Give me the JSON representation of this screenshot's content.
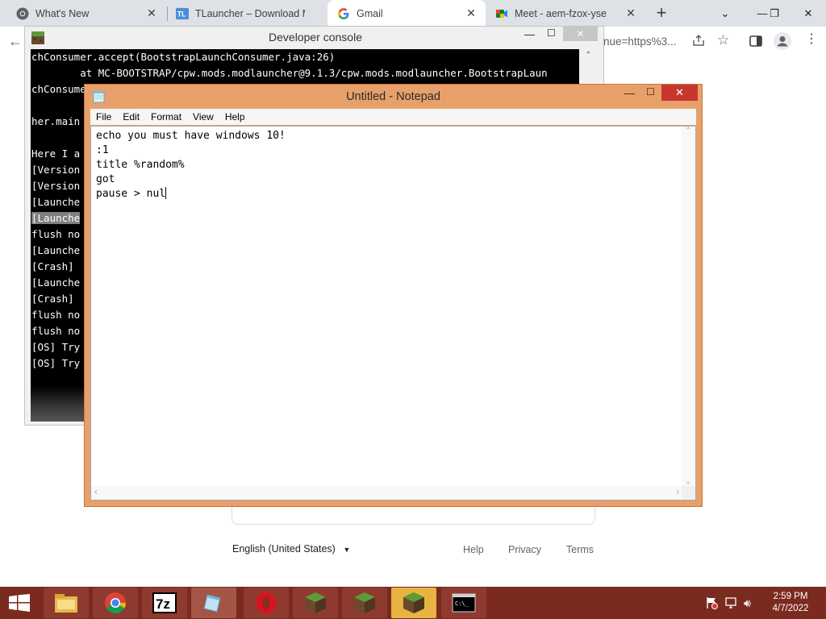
{
  "browser": {
    "tabs": [
      {
        "title": "What's New",
        "icon": "chrome-icon"
      },
      {
        "title": "TLauncher – Download M",
        "icon": "tlauncher-icon"
      },
      {
        "title": "Gmail",
        "icon": "google-icon",
        "active": true
      },
      {
        "title": "Meet - aem-fzox-yse",
        "icon": "meet-icon"
      }
    ],
    "new_tab": "+",
    "url_fragment": "nue=https%3...",
    "footer": {
      "language": "English (United States)",
      "links": [
        "Help",
        "Privacy",
        "Terms"
      ]
    }
  },
  "dev_console": {
    "title": "Developer console",
    "lines": [
      "chConsumer.accept(BootstrapLaunchConsumer.java:26)",
      "        at MC-BOOTSTRAP/cpw.mods.modlauncher@9.1.3/cpw.mods.modlauncher.BootstrapLaun",
      "chConsume",
      "        ",
      "her.main",
      "",
      "Here I a",
      "[Version",
      "[Version",
      "[Launche",
      "[Launche",
      "flush no",
      "[Launche",
      "[Crash] ",
      "[Launche",
      "[Crash] ",
      "flush no",
      "flush no",
      "[OS] Try",
      "[OS] Try"
    ]
  },
  "notepad": {
    "title": "Untitled - Notepad",
    "menu": [
      "File",
      "Edit",
      "Format",
      "View",
      "Help"
    ],
    "lines": [
      "echo you must have windows 10!",
      ":1",
      "title %random%",
      "got",
      "pause > nul"
    ]
  },
  "taskbar": {
    "apps": [
      "file-explorer-icon",
      "chrome-icon",
      "7zip-icon",
      "notepad-icon",
      "opera-icon",
      "minecraft-icon",
      "minecraft-icon",
      "minecraft-icon",
      "cmd-icon"
    ],
    "time": "2:59 PM",
    "date": "4/7/2022"
  },
  "colors": {
    "notepad_frame": "#e8a06a",
    "taskbar": "#7a2a1f",
    "tabstrip": "#dee1e6"
  }
}
